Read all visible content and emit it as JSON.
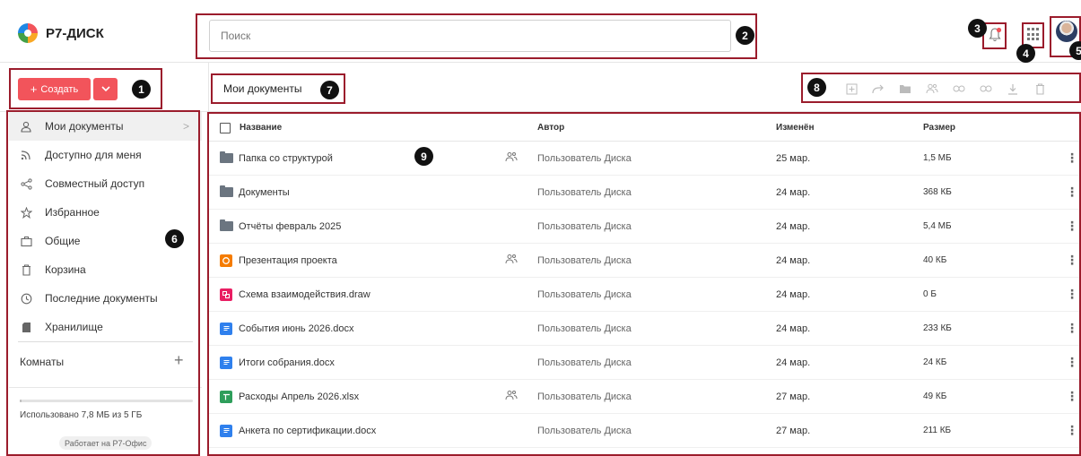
{
  "app": {
    "logo_text": "Р7-ДИСК"
  },
  "search": {
    "placeholder": "Поиск",
    "value": ""
  },
  "header": {
    "notification_dot_color": "#f2545b"
  },
  "toolbar": {
    "create_label": "Создать",
    "breadcrumb": "Мои документы",
    "actions": [
      "create-in-folder-icon",
      "move-icon",
      "folder-icon",
      "share-icon",
      "link-icon",
      "copy-link-icon",
      "download-icon",
      "delete-icon"
    ]
  },
  "sidebar": {
    "items": [
      {
        "label": "Мои документы",
        "icon": "user-icon",
        "active": true
      },
      {
        "label": "Доступно для меня",
        "icon": "rss-icon"
      },
      {
        "label": "Совместный доступ",
        "icon": "share-nodes-icon"
      },
      {
        "label": "Избранное",
        "icon": "star-icon"
      },
      {
        "label": "Общие",
        "icon": "briefcase-icon"
      },
      {
        "label": "Корзина",
        "icon": "trash-icon"
      },
      {
        "label": "Последние документы",
        "icon": "clock-icon"
      },
      {
        "label": "Хранилище",
        "icon": "storage-icon"
      }
    ],
    "rooms_label": "Комнаты",
    "quota_text": "Использовано 7,8 МБ из 5 ГБ",
    "quota_fraction": 0.0016,
    "powered_by": "Работает на Р7-Офис"
  },
  "table": {
    "headers": {
      "name": "Название",
      "author": "Автор",
      "modified": "Изменён",
      "size": "Размер"
    },
    "rows": [
      {
        "name": "Папка со структурой",
        "type": "folder",
        "shared": true,
        "author": "Пользователь Диска",
        "modified": "25 мар.",
        "size": "1,5 МБ"
      },
      {
        "name": "Документы",
        "type": "folder",
        "shared": false,
        "author": "Пользователь Диска",
        "modified": "24 мар.",
        "size": "368 КБ"
      },
      {
        "name": "Отчёты февраль 2025",
        "type": "folder",
        "shared": false,
        "author": "Пользователь Диска",
        "modified": "24 мар.",
        "size": "5,4 МБ"
      },
      {
        "name": "Презентация проекта",
        "type": "presentation",
        "shared": true,
        "author": "Пользователь Диска",
        "modified": "24 мар.",
        "size": "40 КБ"
      },
      {
        "name": "Схема взаимодействия.draw",
        "type": "draw",
        "shared": false,
        "author": "Пользователь Диска",
        "modified": "24 мар.",
        "size": "0 Б"
      },
      {
        "name": "События июнь 2026.docx",
        "type": "docx",
        "shared": false,
        "author": "Пользователь Диска",
        "modified": "24 мар.",
        "size": "233 КБ"
      },
      {
        "name": "Итоги собрания.docx",
        "type": "docx",
        "shared": false,
        "author": "Пользователь Диска",
        "modified": "24 мар.",
        "size": "24 КБ"
      },
      {
        "name": "Расходы Апрель 2026.xlsx",
        "type": "xlsx",
        "shared": true,
        "author": "Пользователь Диска",
        "modified": "27 мар.",
        "size": "49 КБ"
      },
      {
        "name": "Анкета по сертификации.docx",
        "type": "docx",
        "shared": false,
        "author": "Пользователь Диска",
        "modified": "27 мар.",
        "size": "211 КБ"
      }
    ]
  },
  "annotations": [
    "1",
    "2",
    "3",
    "4",
    "5",
    "6",
    "7",
    "8",
    "9"
  ],
  "colors": {
    "accent": "#f2545b",
    "annotation_border": "#9b1c2c",
    "folder": "#6b7580",
    "presentation": "#f57c00",
    "draw": "#e91e63",
    "docx": "#2f80ed",
    "xlsx": "#2e9e5b"
  }
}
